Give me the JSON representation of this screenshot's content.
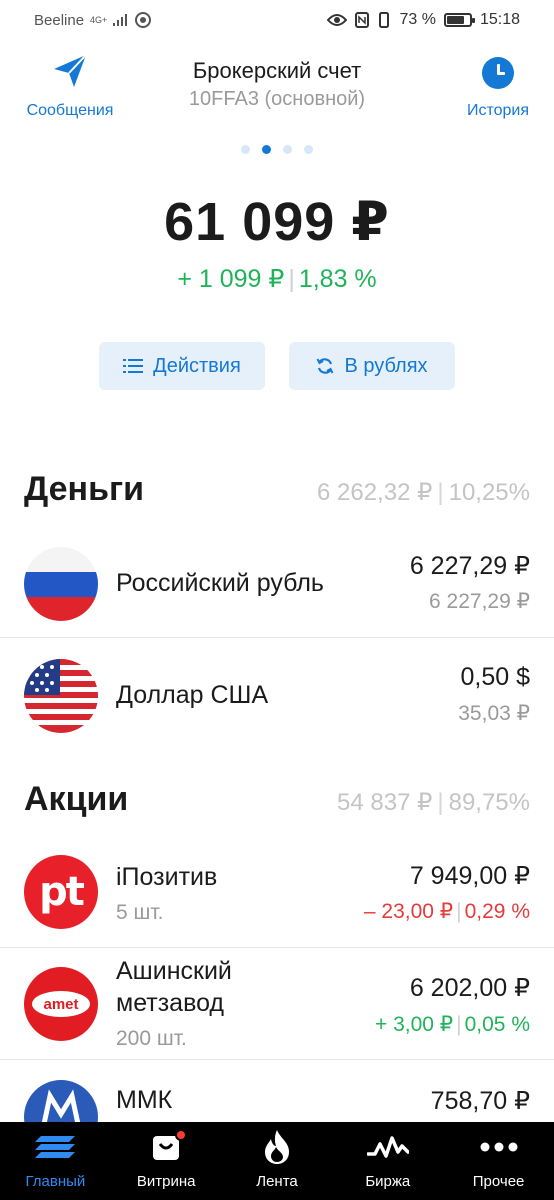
{
  "status_bar": {
    "carrier": "Beeline",
    "network": "4G+",
    "battery_percent": "73 %",
    "time": "15:18"
  },
  "header": {
    "messages_label": "Сообщения",
    "history_label": "История",
    "title": "Брокерский счет",
    "subtitle": "10FFA3 (основной)",
    "page_dots": 4,
    "active_dot": 2
  },
  "portfolio": {
    "total": "61 099 ₽",
    "change_abs": "+ 1 099 ₽",
    "change_pct": "1,83 %"
  },
  "actions": {
    "actions_label": "Действия",
    "currency_label": "В рублях"
  },
  "money": {
    "title": "Деньги",
    "sum": "6 262,32 ₽",
    "share": "10,25%",
    "items": [
      {
        "name": "Российский рубль",
        "value": "6 227,29 ₽",
        "value_rub": "6 227,29 ₽",
        "icon": "russia-flag"
      },
      {
        "name": "Доллар США",
        "value": "0,50 $",
        "value_rub": "35,03 ₽",
        "icon": "usa-flag"
      }
    ]
  },
  "stocks": {
    "title": "Акции",
    "sum": "54 837 ₽",
    "share": "89,75%",
    "items": [
      {
        "name": "iПозитив",
        "qty": "5 шт.",
        "value": "7 949,00 ₽",
        "change_abs": "– 23,00 ₽",
        "change_pct": "0,29 %",
        "trend": "down",
        "logo_text": "pt",
        "logo_color": "#e8202a"
      },
      {
        "name_line1": "Ашинский",
        "name_line2": "метзавод",
        "qty": "200 шт.",
        "value": "6 202,00 ₽",
        "change_abs": "+ 3,00 ₽",
        "change_pct": "0,05 %",
        "trend": "up",
        "logo_text": "amet",
        "logo_color": "#e11d23"
      },
      {
        "name": "ММК",
        "value": "758,70 ₽",
        "logo_color": "#2a5bb8"
      }
    ]
  },
  "tabbar": {
    "items": [
      {
        "label": "Главный",
        "icon": "home-stripes-icon",
        "active": true
      },
      {
        "label": "Витрина",
        "icon": "bag-icon",
        "active": false
      },
      {
        "label": "Лента",
        "icon": "flame-icon",
        "active": false
      },
      {
        "label": "Биржа",
        "icon": "pulse-icon",
        "active": false
      },
      {
        "label": "Прочее",
        "icon": "more-dots-icon",
        "active": false
      }
    ]
  },
  "colors": {
    "accent": "#1479d4",
    "positive": "#21b35a",
    "negative": "#e53b3b",
    "muted": "#9a9a9a"
  }
}
